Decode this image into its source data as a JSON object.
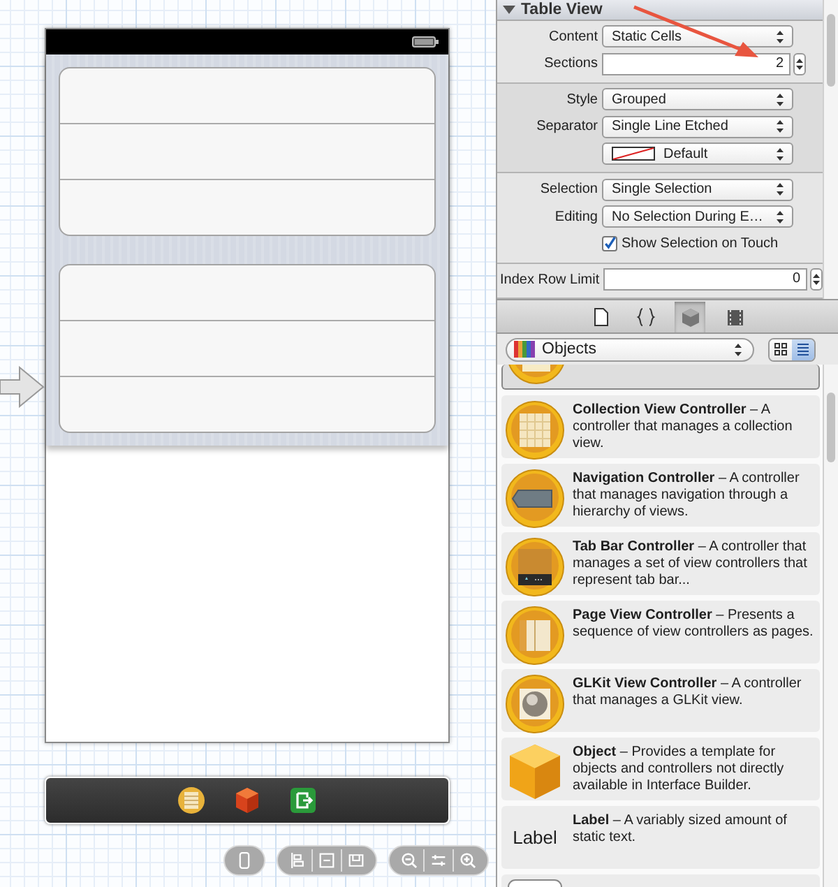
{
  "canvas": {
    "scene": {
      "status_bar": {
        "kind": "battery"
      },
      "sections": [
        {
          "cells": [
            {
              "kind": "blank"
            },
            {
              "kind": "blank"
            },
            {
              "kind": "blank"
            }
          ]
        },
        {
          "cells": [
            {
              "kind": "blank"
            },
            {
              "kind": "blank"
            },
            {
              "kind": "blank"
            }
          ]
        }
      ],
      "entry_point": true
    },
    "dock": [
      {
        "kind": "table"
      },
      {
        "kind": "cube"
      },
      {
        "kind": "exit"
      }
    ],
    "controls": [
      {
        "buttons": [
          {
            "kind": "device"
          }
        ]
      },
      {
        "buttons": [
          {
            "kind": "align"
          },
          {
            "kind": "size"
          },
          {
            "kind": "frame"
          }
        ]
      },
      {
        "buttons": [
          {
            "kind": "zoom-out"
          },
          {
            "kind": "equal"
          },
          {
            "kind": "zoom-in"
          }
        ]
      }
    ]
  },
  "inspector": {
    "title": "Table View",
    "expanded": true,
    "groups": [
      {
        "rows": [
          {
            "kind": "popup",
            "label": "Content",
            "value": "Static Cells"
          },
          {
            "kind": "stepper",
            "label": "Sections",
            "value": "2"
          }
        ]
      },
      {
        "rows": [
          {
            "kind": "popup",
            "label": "Style",
            "value": "Grouped"
          },
          {
            "kind": "popup",
            "label": "Separator",
            "value": "Single Line Etched"
          },
          {
            "kind": "color",
            "value": "Default"
          }
        ]
      },
      {
        "rows": [
          {
            "kind": "popup",
            "label": "Selection",
            "value": "Single Selection"
          },
          {
            "kind": "popup",
            "label": "Editing",
            "value": "No Selection During E…"
          },
          {
            "kind": "checkbox",
            "label": "Show Selection on Touch",
            "checked": true
          }
        ]
      },
      {
        "rows": [
          {
            "kind": "stepper",
            "label": "Index Row Limit",
            "value": "0"
          }
        ]
      }
    ],
    "annotation": {
      "kind": "arrow"
    }
  },
  "library": {
    "tabs": [
      {
        "kind": "file",
        "selected": false
      },
      {
        "kind": "braces",
        "selected": false
      },
      {
        "kind": "cube",
        "selected": true
      },
      {
        "kind": "film",
        "selected": false
      }
    ],
    "filter": {
      "value": "Objects"
    },
    "view_toggles": [
      {
        "kind": "grid",
        "selected": false
      },
      {
        "kind": "list",
        "selected": true
      }
    ],
    "items": [
      {
        "kind": "table",
        "selected": true
      },
      {
        "kind": "collection",
        "selected": false,
        "title": "Collection View Controller",
        "description": " – A controller that manages a collection view."
      },
      {
        "kind": "navigation",
        "selected": false,
        "title": "Navigation Controller",
        "description": " – A controller that manages navigation through a hierarchy of views."
      },
      {
        "kind": "tabbar",
        "selected": false,
        "title": "Tab Bar Controller",
        "description": " – A controller that manages a set of view controllers that represent tab bar..."
      },
      {
        "kind": "pageview",
        "selected": false,
        "title": "Page View Controller",
        "description": " – Presents a sequence of view controllers as pages."
      },
      {
        "kind": "glkit",
        "selected": false,
        "title": "GLKit View Controller",
        "description": " – A controller that manages a GLKit view."
      },
      {
        "kind": "object",
        "selected": false,
        "title": "Object",
        "description": " – Provides a template for objects and controllers not directly available in Interface Builder."
      },
      {
        "kind": "label",
        "selected": false,
        "icon_text": "Label",
        "title": "Label",
        "description": " – A variably sized amount of static text."
      },
      {
        "kind": "button",
        "selected": false
      }
    ]
  }
}
